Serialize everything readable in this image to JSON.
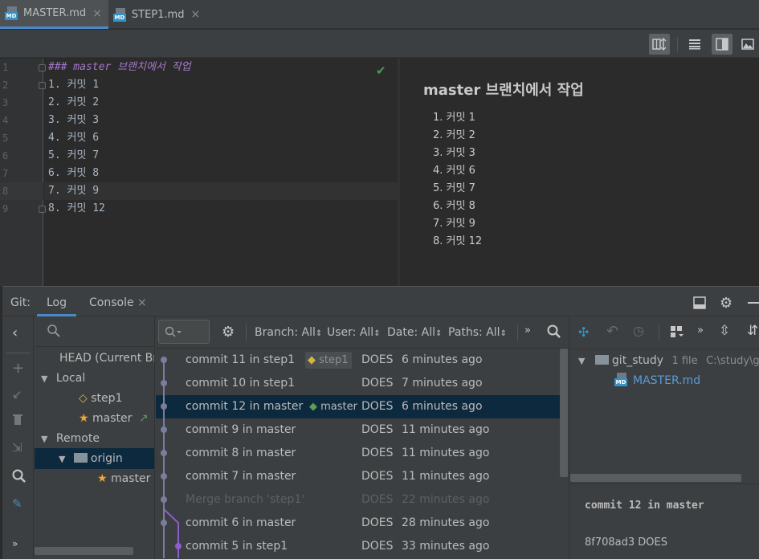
{
  "tabs": [
    {
      "label": "MASTER.md",
      "icon": "markdown-file-icon",
      "active": true
    },
    {
      "label": "STEP1.md",
      "icon": "markdown-file-icon",
      "active": false
    }
  ],
  "file_icon_label": "MD",
  "editor": {
    "line_numbers": [
      "1",
      "2",
      "3",
      "4",
      "5",
      "6",
      "7",
      "8",
      "9"
    ],
    "lines": [
      "### master 브랜치에서 작업",
      "1. 커밋 1",
      "2. 커밋 2",
      "3. 커밋 3",
      "4. 커밋 6",
      "5. 커밋 7",
      "6. 커밋 8",
      "7. 커밋 9",
      "8. 커밋 12"
    ]
  },
  "preview": {
    "title": "master 브랜치에서 작업",
    "items": [
      "1. 커밋 1",
      "2. 커밋 2",
      "3. 커밋 3",
      "4. 커밋 6",
      "5. 커밋 7",
      "6. 커밋 8",
      "7. 커밋 9",
      "8. 커밋 12"
    ]
  },
  "git": {
    "label": "Git:",
    "tabs": [
      {
        "label": "Log",
        "active": true
      },
      {
        "label": "Console",
        "active": false
      }
    ],
    "branches": {
      "head": "HEAD (Current Branch)",
      "local": "Local",
      "local_items": [
        "step1",
        "master"
      ],
      "remote": "Remote",
      "origin": "origin",
      "remote_items": [
        "master"
      ]
    },
    "filters": {
      "branch": "Branch: All",
      "user": "User: All",
      "date": "Date: All",
      "paths": "Paths: All"
    },
    "commits": [
      {
        "message": "commit 11 in step1",
        "tag": "step1",
        "author": "DOES",
        "date": "6 minutes ago",
        "dim": false
      },
      {
        "message": "commit 10 in step1",
        "tag": "",
        "author": "DOES",
        "date": "7 minutes ago",
        "dim": false
      },
      {
        "message": "commit 12 in master",
        "tag": "master",
        "author": "DOES",
        "date": "6 minutes ago",
        "dim": false
      },
      {
        "message": "commit 9 in master",
        "tag": "",
        "author": "DOES",
        "date": "11 minutes ago",
        "dim": false
      },
      {
        "message": "commit 8 in master",
        "tag": "",
        "author": "DOES",
        "date": "11 minutes ago",
        "dim": false
      },
      {
        "message": "commit 7 in master",
        "tag": "",
        "author": "DOES",
        "date": "11 minutes ago",
        "dim": false
      },
      {
        "message": "Merge branch 'step1'",
        "tag": "",
        "author": "DOES",
        "date": "22 minutes ago",
        "dim": true
      },
      {
        "message": "commit 6 in master",
        "tag": "",
        "author": "DOES",
        "date": "28 minutes ago",
        "dim": false
      },
      {
        "message": "commit 5 in step1",
        "tag": "",
        "author": "DOES",
        "date": "33 minutes ago",
        "dim": false
      }
    ],
    "details": {
      "repo": "git_study",
      "file_count": "1 file",
      "path": "C:\\study\\git_study",
      "file": "MASTER.md",
      "commit_title": "commit 12 in master",
      "hash_author": "8f708ad3 DOES"
    }
  },
  "colors": {
    "accent": "#4a88c7",
    "selection": "#0d293e",
    "graph_gray": "#7a7e9c",
    "graph_purple": "#8d5dc9",
    "success": "#499c54",
    "tag_green": "#5c9e52",
    "tag_yellow": "#d4b542",
    "star": "#f0a732"
  }
}
